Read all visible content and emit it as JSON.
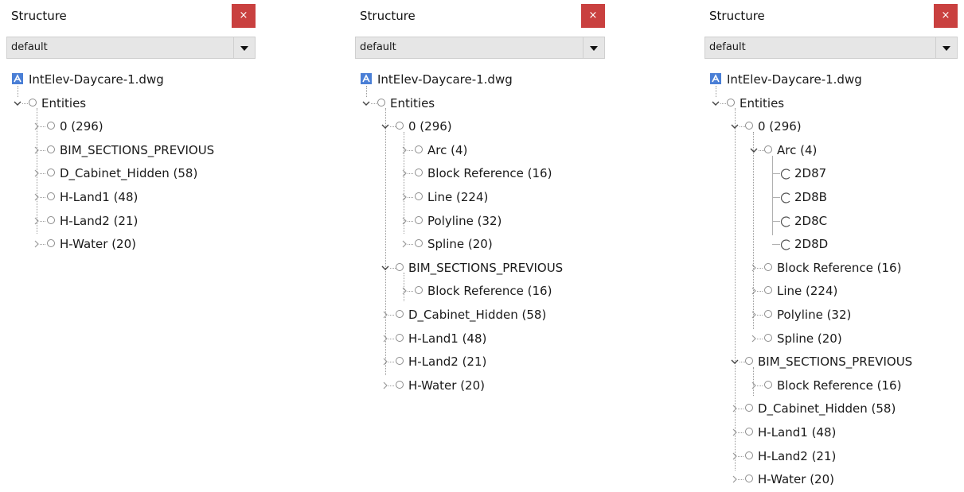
{
  "panels": [
    {
      "title": "Structure",
      "close_label": "×",
      "layer_select": "default",
      "file_name": "IntElev-Daycare-1.dwg",
      "entities_label": "Entities",
      "layers": [
        "0 (296)",
        "BIM_SECTIONS_PREVIOUS",
        "D_Cabinet_Hidden (58)",
        "H-Land1 (48)",
        "H-Land2 (21)",
        "H-Water (20)"
      ]
    },
    {
      "title": "Structure",
      "close_label": "×",
      "layer_select": "default",
      "file_name": "IntElev-Daycare-1.dwg",
      "entities_label": "Entities",
      "layer0": "0 (296)",
      "layer0_children": [
        "Arc (4)",
        "Block Reference (16)",
        "Line (224)",
        "Polyline (32)",
        "Spline (20)"
      ],
      "bim": "BIM_SECTIONS_PREVIOUS",
      "bim_children": [
        "Block Reference (16)"
      ],
      "other_layers": [
        "D_Cabinet_Hidden (58)",
        "H-Land1 (48)",
        "H-Land2 (21)",
        "H-Water (20)"
      ]
    },
    {
      "title": "Structure",
      "close_label": "×",
      "layer_select": "default",
      "file_name": "IntElev-Daycare-1.dwg",
      "entities_label": "Entities",
      "layer0": "0 (296)",
      "arc": "Arc (4)",
      "arc_children": [
        "2D87",
        "2D8B",
        "2D8C",
        "2D8D"
      ],
      "layer0_children": [
        "Block Reference (16)",
        "Line (224)",
        "Polyline (32)",
        "Spline (20)"
      ],
      "bim": "BIM_SECTIONS_PREVIOUS",
      "bim_children": [
        "Block Reference (16)"
      ],
      "other_layers": [
        "D_Cabinet_Hidden (58)",
        "H-Land1 (48)",
        "H-Land2 (21)",
        "H-Water (20)"
      ]
    }
  ],
  "colors": {
    "close_bg": "#c9403f",
    "file_icon": "#4a7fd6",
    "select_bg": "#e6e6e6"
  }
}
